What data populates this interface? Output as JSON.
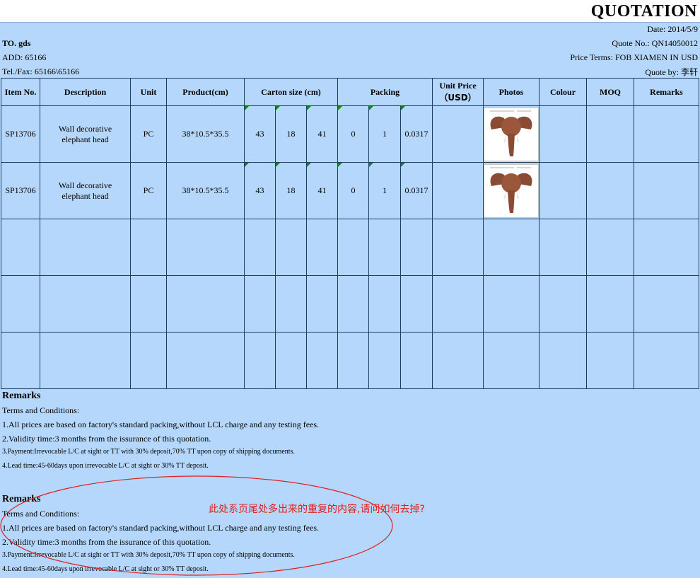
{
  "header": {
    "title": "QUOTATION",
    "date": "Date: 2014/5/9",
    "to": "TO. gds",
    "quote_no": "Quote No.: QN14050012",
    "add": "ADD:  65166",
    "price_terms": "Price Terms: FOB XIAMEN IN USD",
    "tel": "Tel./Fax: 65166\\65166",
    "quote_by_label": "Quote by: ",
    "quote_by_name": "李轩"
  },
  "table": {
    "headers": {
      "item_no": "Item No.",
      "description": "Description",
      "unit": "Unit",
      "product": "Product(cm)",
      "carton_size": "Carton size (cm)",
      "packing": "Packing",
      "unit_price_1": "Unit Price",
      "unit_price_2": "（USD）",
      "photos": "Photos",
      "colour": "Colour",
      "moq": "MOQ",
      "remarks": "Remarks"
    },
    "rows": [
      {
        "item_no": "SP13706",
        "description_1": "Wall decorative",
        "description_2": "elephant head",
        "unit": "PC",
        "product": "38*10.5*35.5",
        "carton_l": "43",
        "carton_w": "18",
        "carton_h": "41",
        "packing_a": "0",
        "packing_b": "1",
        "packing_c": "0.0317"
      },
      {
        "item_no": "SP13706",
        "description_1": "Wall decorative",
        "description_2": "elephant head",
        "unit": "PC",
        "product": "38*10.5*35.5",
        "carton_l": "43",
        "carton_w": "18",
        "carton_h": "41",
        "packing_a": "0",
        "packing_b": "1",
        "packing_c": "0.0317"
      }
    ]
  },
  "remarks": {
    "heading": "Remarks",
    "terms": "Terms and Conditions:",
    "items": [
      "1.All prices are based on factory's standard packing,without LCL charge and any testing fees.",
      "2.Validity time:3 months from the issurance of this quotation.",
      "3.Payment:Irrevocable L/C at sight or TT with 30% deposit,70% TT upon copy of shipping documents.",
      "4.Lead time:45-60days upon irrevocable L/C at sight or 30% TT deposit."
    ]
  },
  "annotation": {
    "note": "此处系页尾处多出来的重复的内容,请问如何去掉?",
    "color": "#e02020"
  },
  "colors": {
    "sheet_bg": "#b5d7fb",
    "grid_line": "#1f3d63",
    "marker_green": "#0a8a0a"
  }
}
